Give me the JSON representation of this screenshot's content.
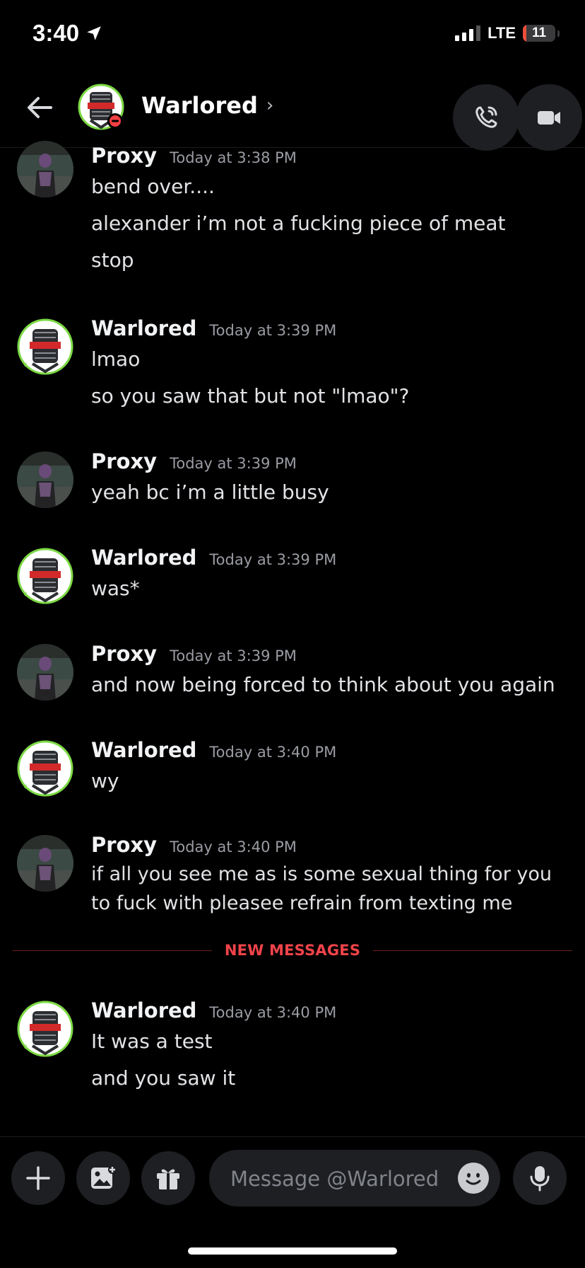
{
  "status_bar": {
    "time": "3:40",
    "network": "LTE",
    "battery": "11",
    "battery_level": 0.11
  },
  "header": {
    "name": "Warlored",
    "chevron": "›"
  },
  "messages": [
    {
      "author": "Proxy",
      "time": "Today at 3:38 PM",
      "lines": [
        "bend over....",
        "alexander i’m not a fucking piece of meat",
        "stop"
      ]
    },
    {
      "author": "Warlored",
      "time": "Today at 3:39 PM",
      "lines": [
        "lmao",
        "so you saw that but not \"lmao\"?"
      ]
    },
    {
      "author": "Proxy",
      "time": "Today at 3:39 PM",
      "lines": [
        "yeah bc i’m a little busy"
      ]
    },
    {
      "author": "Warlored",
      "time": "Today at 3:39 PM",
      "lines": [
        "was*"
      ]
    },
    {
      "author": "Proxy",
      "time": "Today at 3:39 PM",
      "lines": [
        "and now being forced to think about  you again"
      ]
    },
    {
      "author": "Warlored",
      "time": "Today at 3:40 PM",
      "lines": [
        "wy"
      ]
    },
    {
      "author": "Proxy",
      "time": "Today at 3:40 PM",
      "lines": [
        "if all you see me as is some sexual thing for you to fuck with pleasee refrain from texting me"
      ]
    },
    {
      "author": "Warlored",
      "time": "Today at 3:40 PM",
      "lines": [
        "It was a test",
        "and you saw it"
      ]
    }
  ],
  "divider": {
    "label": "NEW MESSAGES"
  },
  "composer": {
    "placeholder": "Message @Warlored"
  },
  "colors": {
    "background": "#000000",
    "new_messages_red": "#f0434a",
    "dnd_red": "#f23f43",
    "avatar_ring_green": "#7cd944"
  }
}
